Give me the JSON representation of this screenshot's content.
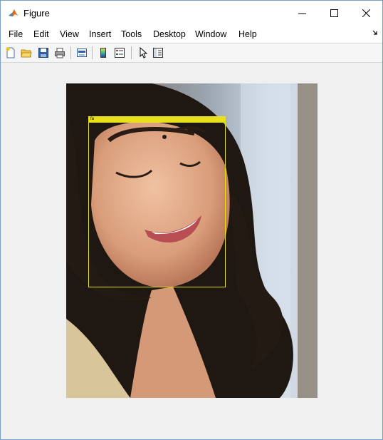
{
  "window": {
    "title": "Figure",
    "icon": "matlab-icon",
    "controls": [
      "minimize-icon",
      "maximize-icon",
      "close-icon"
    ]
  },
  "menu": {
    "items": [
      "File",
      "Edit",
      "View",
      "Insert",
      "Tools",
      "Desktop",
      "Window",
      "Help"
    ],
    "dock_icon": "dock-arrow-icon"
  },
  "toolbar": {
    "buttons": [
      "new-figure-icon",
      "open-file-icon",
      "save-icon",
      "print-icon",
      "link-plot-icon",
      "insert-colorbar-icon",
      "insert-legend-icon",
      "edit-plot-pointer-icon",
      "property-inspector-icon"
    ]
  },
  "figure": {
    "image_content": "photo of smiling woman with curly hair",
    "annotation": {
      "label": "fa",
      "color": "#e8e01a"
    }
  }
}
